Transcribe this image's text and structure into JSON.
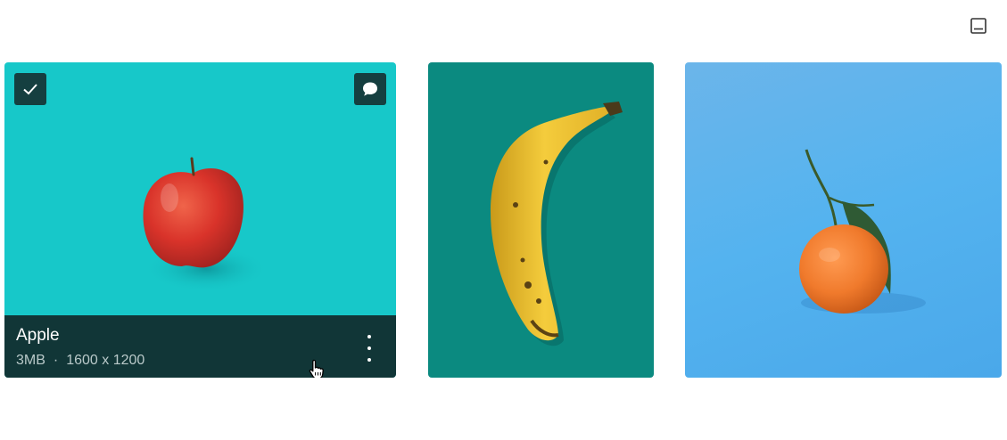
{
  "toolbar": {
    "icon": "panel-bottom-icon"
  },
  "cards": [
    {
      "name": "Apple",
      "size": "3MB",
      "separator": "·",
      "dimensions": "1600 x 1200",
      "selected": true,
      "background": "#17c8c9",
      "icons": [
        "checkbox-checked-icon",
        "comment-icon",
        "more-vertical-icon"
      ]
    },
    {
      "subject": "banana",
      "background": "#0b8a80"
    },
    {
      "subject": "mandarin orange",
      "background": "#54b3ef"
    }
  ],
  "colors": {
    "caption_bar": "#113637",
    "overlay_button": "#153f40",
    "caption_text": "#ffffff",
    "caption_meta": "#b9c9c9"
  }
}
